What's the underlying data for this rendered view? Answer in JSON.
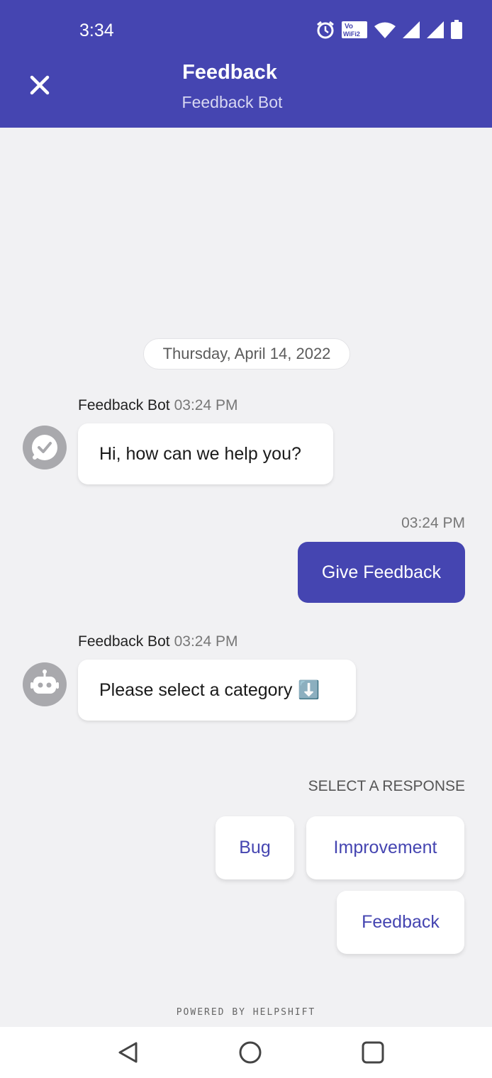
{
  "status_bar": {
    "time": "3:34",
    "wifi_badge_top": "Vo",
    "wifi_badge_bottom": "WiFi2"
  },
  "header": {
    "title": "Feedback",
    "subtitle": "Feedback Bot",
    "close_icon": "close-icon",
    "background": "#4545b1"
  },
  "chat": {
    "date": "Thursday, April 14, 2022",
    "messages": [
      {
        "sender": "Feedback Bot",
        "time": "03:24 PM",
        "text": "Hi, how can we help you?",
        "avatar": "check-chat-icon"
      },
      {
        "sender": "user",
        "time": "03:24 PM",
        "text": "Give Feedback"
      },
      {
        "sender": "Feedback Bot",
        "time": "03:24 PM",
        "text": "Please select a category",
        "emoji": "⬇️",
        "avatar": "robot-icon"
      }
    ]
  },
  "responses": {
    "label": "SELECT A RESPONSE",
    "options": [
      "Bug",
      "Improvement",
      "Feedback"
    ]
  },
  "footer": {
    "powered_by": "POWERED BY HELPSHIFT"
  },
  "nav_bar": {
    "back_icon": "back-triangle-icon",
    "home_icon": "home-circle-icon",
    "recents_icon": "recents-square-icon"
  },
  "colors": {
    "accent": "#4545b1",
    "background": "#f1f1f3",
    "bubble": "#ffffff"
  }
}
